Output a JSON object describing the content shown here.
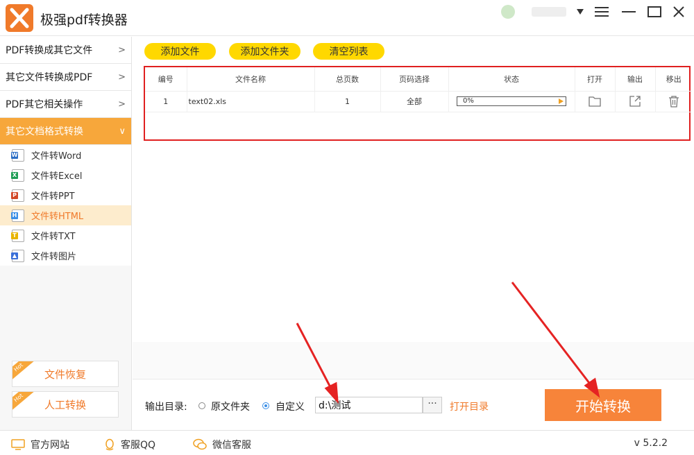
{
  "app": {
    "title": "极强pdf转换器",
    "version": "v 5.2.2"
  },
  "sidebar": {
    "categories": [
      {
        "label": "PDF转换成其它文件",
        "chev": ">"
      },
      {
        "label": "其它文件转换成PDF",
        "chev": ">"
      },
      {
        "label": "PDF其它相关操作",
        "chev": ">"
      },
      {
        "label": "其它文档格式转换",
        "chev": "∨"
      }
    ],
    "sub_items": [
      {
        "label": "文件转Word",
        "icon": "word-icon",
        "color": "#2b6ec5",
        "tag": "W"
      },
      {
        "label": "文件转Excel",
        "icon": "excel-icon",
        "color": "#1f9d55",
        "tag": "X"
      },
      {
        "label": "文件转PPT",
        "icon": "ppt-icon",
        "color": "#d24726",
        "tag": "P"
      },
      {
        "label": "文件转HTML",
        "icon": "html-icon",
        "color": "#3a8ee6",
        "tag": "H"
      },
      {
        "label": "文件转TXT",
        "icon": "txt-icon",
        "color": "#e8b400",
        "tag": "T"
      },
      {
        "label": "文件转图片",
        "icon": "image-icon",
        "color": "#3a6fd8",
        "tag": "▲"
      }
    ],
    "file_recovery": "文件恢复",
    "manual_convert": "人工转换",
    "hot": "Hot"
  },
  "toolbar": {
    "add_file": "添加文件",
    "add_folder": "添加文件夹",
    "clear_list": "清空列表"
  },
  "table": {
    "headers": [
      "编号",
      "文件名称",
      "总页数",
      "页码选择",
      "状态",
      "打开",
      "输出",
      "移出"
    ],
    "rows": [
      {
        "index": "1",
        "name": "text02.xls",
        "pages": "1",
        "range": "全部",
        "progress": "0%"
      }
    ]
  },
  "output": {
    "label": "输出目录:",
    "option_original": "原文件夹",
    "option_custom": "自定义",
    "selected": "自定义",
    "path": "d:\\测试",
    "browse": "···",
    "open_dir": "打开目录",
    "start": "开始转换"
  },
  "statusbar": {
    "website": "官方网站",
    "qq": "客服QQ",
    "wechat": "微信客服"
  },
  "colors": {
    "accent": "#f7843a",
    "active_nav": "#f7a73b",
    "toolbar_button": "#ffd800",
    "highlight_border": "#e02020"
  }
}
